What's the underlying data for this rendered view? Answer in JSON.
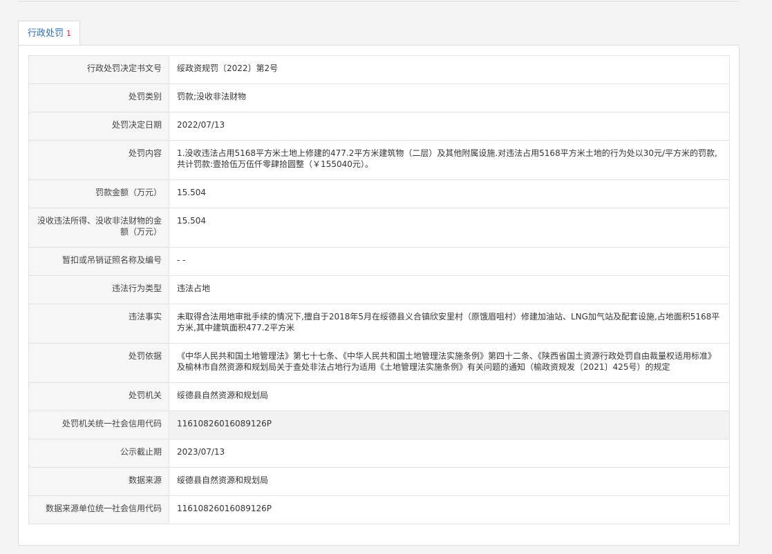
{
  "tab": {
    "label": "行政处罚",
    "count": "1"
  },
  "rows": [
    {
      "label": "行政处罚决定书文号",
      "value": "绥政资规罚〔2022〕第2号"
    },
    {
      "label": "处罚类别",
      "value": "罚款;没收非法财物"
    },
    {
      "label": "处罚决定日期",
      "value": "2022/07/13"
    },
    {
      "label": "处罚内容",
      "value": "1.没收违法占用5168平方米土地上修建的477.2平方米建筑物（二层）及其他附属设施.对违法占用5168平方米土地的行为处以30元/平方米的罚款,共计罚款:壹拾伍万伍仟零肆拾圆整（￥155040元）。"
    },
    {
      "label": "罚款金额（万元）",
      "value": "15.504"
    },
    {
      "label": "没收违法所得、没收非法财物的金额（万元）",
      "value": "15.504"
    },
    {
      "label": "暂扣或吊销证照名称及编号",
      "value": "- -"
    },
    {
      "label": "违法行为类型",
      "value": "违法占地"
    },
    {
      "label": "违法事实",
      "value": "未取得合法用地审批手续的情况下,擅自于2018年5月在绥德县义合镇欣安里村（原饿眉咀村）修建加油站、LNG加气站及配套设施,占地面积5168平方米,其中建筑面积477.2平方米"
    },
    {
      "label": "处罚依据",
      "value": "《中华人民共和国土地管理法》第七十七条、《中华人民共和国土地管理法实施条例》第四十二条、《陕西省国土资源行政处罚自由裁量权适用标准》及榆林市自然资源和规划局关于查处非法占地行为适用《土地管理法实施条例》有关问题的通知（榆政资规发〔2021〕425号）的规定"
    },
    {
      "label": "处罚机关",
      "value": "绥德县自然资源和规划局"
    },
    {
      "label": "处罚机关统一社会信用代码",
      "value": "11610826016089126P"
    },
    {
      "label": "公示截止期",
      "value": "2023/07/13"
    },
    {
      "label": "数据来源",
      "value": "绥德县自然资源和规划局"
    },
    {
      "label": "数据来源单位统一社会信用代码",
      "value": "11610826016089126P"
    }
  ]
}
